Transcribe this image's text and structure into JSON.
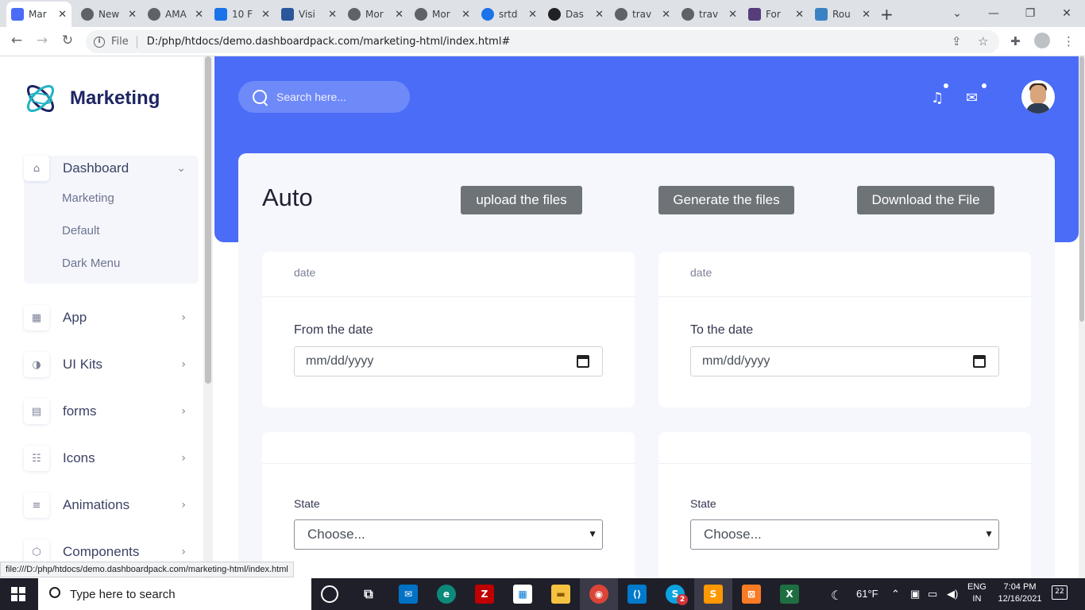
{
  "browser": {
    "tabs": [
      {
        "label": "Mar",
        "color": "#4a6cf7",
        "active": true
      },
      {
        "label": "New",
        "color": "#5f6368"
      },
      {
        "label": "AMA",
        "color": "#5f6368"
      },
      {
        "label": "10 F",
        "color": "#1a73e8"
      },
      {
        "label": "Visi",
        "color": "#2b579a"
      },
      {
        "label": "Mor",
        "color": "#5f6368"
      },
      {
        "label": "Mor",
        "color": "#5f6368"
      },
      {
        "label": "srtd",
        "color": "#1a73e8"
      },
      {
        "label": "Das",
        "color": "#202124"
      },
      {
        "label": "trav",
        "color": "#5f6368"
      },
      {
        "label": "trav",
        "color": "#5f6368"
      },
      {
        "label": "For",
        "color": "#563d7c"
      },
      {
        "label": "Rou",
        "color": "#3b82c4"
      }
    ],
    "new_tab": "+",
    "tab_close": "✕",
    "url": "D:/php/htdocs/demo.dashboardpack.com/marketing-html/index.html#",
    "file_label": "File",
    "status_url": "file:///D:/php/htdocs/demo.dashboardpack.com/marketing-html/index.html"
  },
  "sidebar": {
    "brand": "Marketing",
    "dashboard": {
      "label": "Dashboard",
      "children": [
        "Marketing",
        "Default",
        "Dark Menu"
      ]
    },
    "items": [
      {
        "label": "App",
        "icon": "app-grid-icon"
      },
      {
        "label": "UI Kits",
        "icon": "ui-kits-icon"
      },
      {
        "label": "forms",
        "icon": "forms-icon"
      },
      {
        "label": "Icons",
        "icon": "icons-icon"
      },
      {
        "label": "Animations",
        "icon": "animations-icon"
      },
      {
        "label": "Components",
        "icon": "components-icon"
      }
    ]
  },
  "header": {
    "search_placeholder": "Search here...",
    "accent": "#4a6cf7"
  },
  "content": {
    "title": "Auto",
    "buttons": {
      "upload": "upload the files",
      "generate": "Generate the files",
      "download": "Download the File"
    },
    "from_card": {
      "head": "date",
      "label": "From the date",
      "placeholder": "mm/dd/yyyy"
    },
    "to_card": {
      "head": "date",
      "label": "To the date",
      "placeholder": "mm/dd/yyyy"
    },
    "state_left": {
      "label": "State",
      "selected": "Choose..."
    },
    "state_right": {
      "label": "State",
      "selected": "Choose..."
    }
  },
  "taskbar": {
    "search_placeholder": "Type here to search",
    "weather": "61°F",
    "lang_line1": "ENG",
    "lang_line2": "IN",
    "time": "7:04 PM",
    "date": "12/16/2021",
    "notifications": "22",
    "skype_badge": "2"
  }
}
